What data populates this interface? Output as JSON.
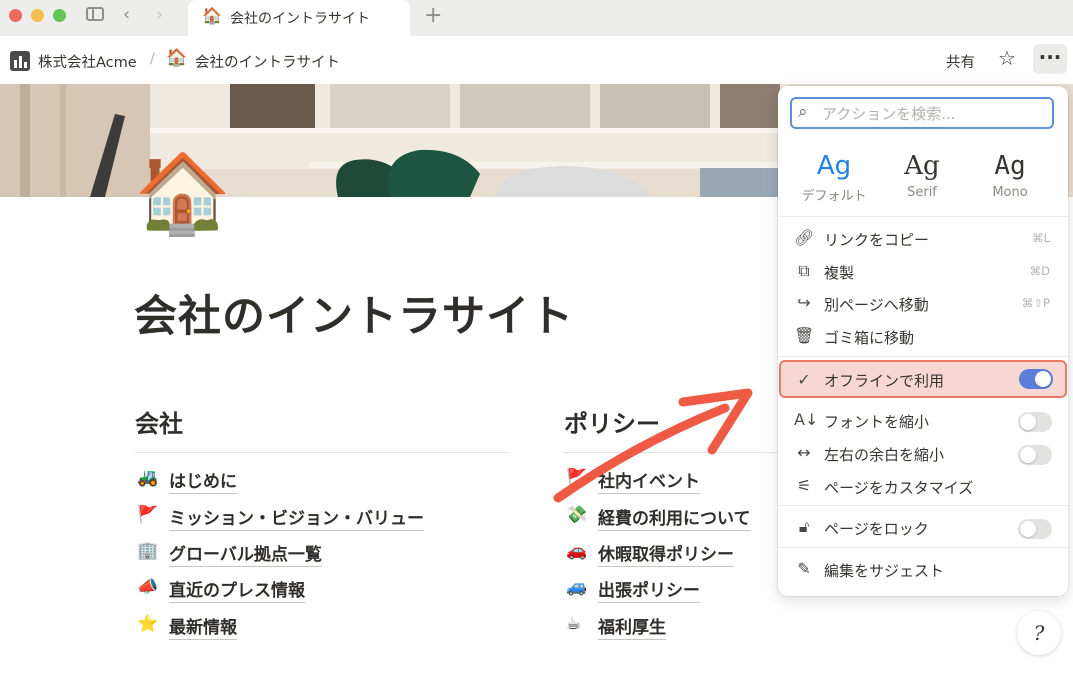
{
  "browser": {
    "tab_title": "会社のイントラサイト",
    "tab_emoji": "🏠",
    "new_tab": "+"
  },
  "breadcrumb": {
    "workspace": "株式会社Acme",
    "separator": "/",
    "page_emoji": "🏠",
    "page": "会社のイントラサイト"
  },
  "topbar": {
    "share": "共有",
    "star": "☆",
    "more": "···"
  },
  "page": {
    "icon": "🏠",
    "title": "会社のイントラサイト"
  },
  "sections": [
    {
      "heading": "会社",
      "items": [
        {
          "emoji": "🚜",
          "label": "はじめに"
        },
        {
          "emoji": "🚩",
          "label": "ミッション・ビジョン・バリュー"
        },
        {
          "emoji": "🏢",
          "label": "グローバル拠点一覧"
        },
        {
          "emoji": "📣",
          "label": "直近のプレス情報"
        },
        {
          "emoji": "⭐",
          "label": "最新情報"
        }
      ]
    },
    {
      "heading": "ポリシー",
      "items": [
        {
          "emoji": "🚩",
          "label": "社内イベント"
        },
        {
          "emoji": "💸",
          "label": "経費の利用について"
        },
        {
          "emoji": "🚗",
          "label": "休暇取得ポリシー"
        },
        {
          "emoji": "🚙",
          "label": "出張ポリシー"
        },
        {
          "emoji": "☕",
          "label": "福利厚生"
        }
      ]
    }
  ],
  "menu": {
    "search_placeholder": "アクションを検索...",
    "fonts": [
      {
        "sample": "Ag",
        "name": "デフォルト",
        "selected": true
      },
      {
        "sample": "Ag",
        "name": "Serif",
        "selected": false
      },
      {
        "sample": "Ag",
        "name": "Mono",
        "selected": false
      }
    ],
    "items": {
      "copy_link": {
        "label": "リンクをコピー",
        "shortcut": "⌘L"
      },
      "duplicate": {
        "label": "複製",
        "shortcut": "⌘D"
      },
      "move_to": {
        "label": "別ページへ移動",
        "shortcut": "⌘⇧P"
      },
      "trash": {
        "label": "ゴミ箱に移動"
      },
      "offline": {
        "label": "オフラインで利用",
        "enabled": true
      },
      "small_text": {
        "label": "フォントを縮小",
        "enabled": false
      },
      "full_width": {
        "label": "左右の余白を縮小",
        "enabled": false
      },
      "customize": {
        "label": "ページをカスタマイズ"
      },
      "lock": {
        "label": "ページをロック",
        "enabled": false
      },
      "suggest": {
        "label": "編集をサジェスト"
      }
    }
  },
  "colors": {
    "highlight_bg": "#f7d7d2",
    "highlight_border": "#e97a66",
    "toggle_on": "#5b7fd9",
    "annotation_arrow": "#ef5a44"
  }
}
